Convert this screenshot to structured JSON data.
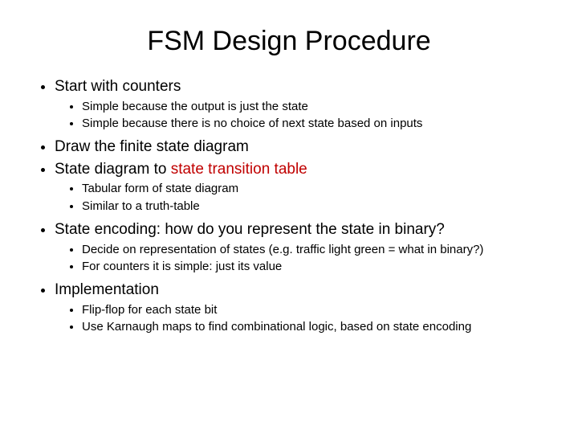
{
  "title": "FSM Design Procedure",
  "b1": "Start with counters",
  "b1_1": "Simple because the output is just the state",
  "b1_2": "Simple because there is no choice of next state based on inputs",
  "b2": "Draw the finite state diagram",
  "b3_pre": "State diagram to ",
  "b3_red": "state transition table",
  "b3_1": "Tabular form of state diagram",
  "b3_2": "Similar to a truth-table",
  "b4": "State encoding: how do you represent the state in binary?",
  "b4_1": "Decide on representation of states (e.g. traffic light green = what in binary?)",
  "b4_2": "For counters it is simple: just its value",
  "b5": "Implementation",
  "b5_1": "Flip-flop for each state bit",
  "b5_2": "Use Karnaugh maps to find combinational logic, based on state encoding"
}
